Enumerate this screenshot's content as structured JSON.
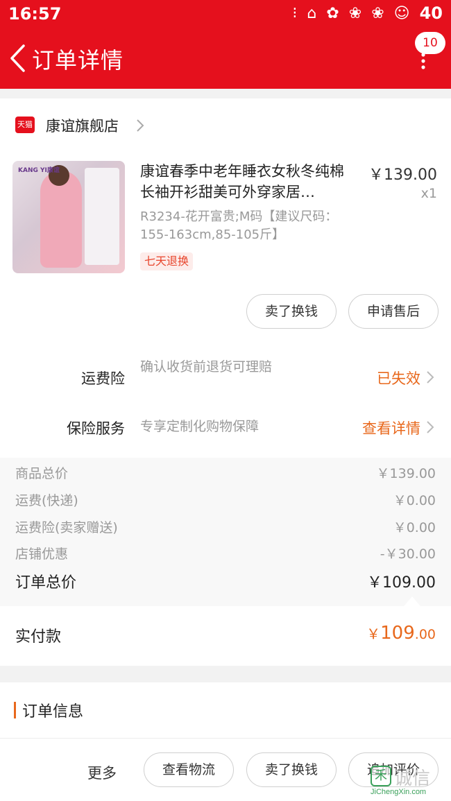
{
  "status_bar": {
    "time": "16:57",
    "battery": "40",
    "icons": [
      "notification-icon",
      "fish-icon",
      "lollipop-icon",
      "paw-icon",
      "paw-icon",
      "cat-icon"
    ]
  },
  "nav": {
    "title": "订单详情",
    "badge_count": "10",
    "colors": {
      "brand": "#e5101d"
    }
  },
  "store": {
    "badge_text": "天猫",
    "name": "康谊旗舰店"
  },
  "product": {
    "image_brand": "KANG YI康谊",
    "title": "康谊春季中老年睡衣女秋冬纯棉长袖开衫甜美可外穿家居…",
    "price": "￥139.00",
    "quantity": "x1",
    "sku": "R3234-花开富贵;M码【建议尺码：155-163cm,85-105斤】",
    "tag": "七天退换"
  },
  "actions": {
    "sell": "卖了换钱",
    "after_sale": "申请售后"
  },
  "insurance": [
    {
      "label": "运费险",
      "desc": "确认收货前退货可理赔",
      "status": "已失效"
    },
    {
      "label": "保险服务",
      "desc": "专享定制化购物保障",
      "status": "查看详情"
    }
  ],
  "summary": {
    "rows": [
      {
        "label": "商品总价",
        "value": "￥139.00"
      },
      {
        "label": "运费(快递)",
        "value": "￥0.00"
      },
      {
        "label": "运费险(卖家赠送)",
        "value": "￥0.00"
      },
      {
        "label": "店铺优惠",
        "value": "-￥30.00"
      }
    ],
    "total_label": "订单总价",
    "total_value": "￥109.00"
  },
  "paid": {
    "label": "实付款",
    "symbol": "￥",
    "integer": "109",
    "decimal": ".00"
  },
  "order_info": {
    "title": "订单信息"
  },
  "bottom": {
    "more": "更多",
    "logistics": "查看物流",
    "sell": "卖了换钱",
    "review": "追加评价"
  },
  "watermark": {
    "big": "诚信",
    "small": "JiChengXin.com"
  }
}
